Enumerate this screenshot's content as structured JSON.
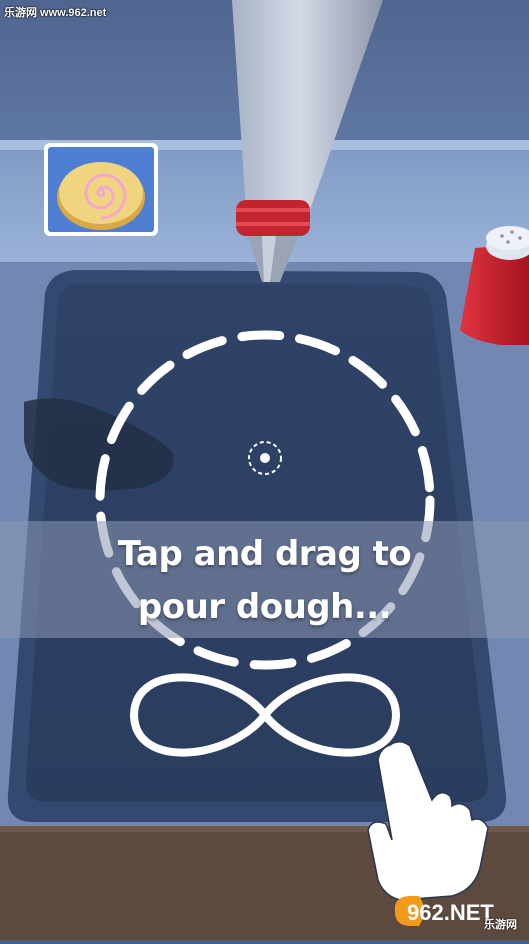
{
  "watermark": {
    "top_left": "乐游网 www.962.net"
  },
  "target": {
    "name": "swirl-bun-target-icon"
  },
  "hint": {
    "line1": "Tap and drag to",
    "line2": "pour dough..."
  },
  "gesture": {
    "icon": "infinity-swipe-icon",
    "hand": "pointing-hand-icon"
  },
  "logo": {
    "brand": "962.NET",
    "sub": "乐游网"
  },
  "colors": {
    "background": "#4a5f86",
    "tray": "#2c3f63",
    "counter": "#5d4a3f",
    "cup": "#c8202b",
    "target_card_bg": "#4e7fd3"
  }
}
